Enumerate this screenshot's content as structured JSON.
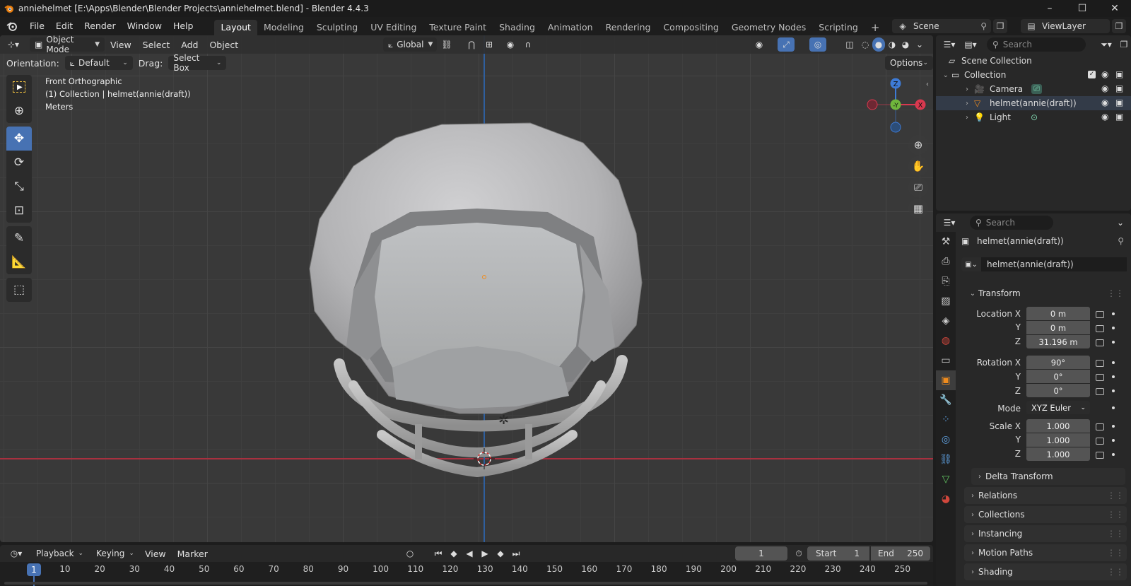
{
  "window": {
    "title": "anniehelmet [E:\\Apps\\Blender\\Blender Projects\\anniehelmet.blend] - Blender 4.4.3",
    "controls": [
      "–",
      "☐",
      "✕"
    ]
  },
  "menubar": {
    "items": [
      "File",
      "Edit",
      "Render",
      "Window",
      "Help"
    ],
    "workspaces": [
      "Layout",
      "Modeling",
      "Sculpting",
      "UV Editing",
      "Texture Paint",
      "Shading",
      "Animation",
      "Rendering",
      "Compositing",
      "Geometry Nodes",
      "Scripting"
    ],
    "active_workspace": "Layout",
    "add_tab": "+",
    "scene": "Scene",
    "view_layer": "ViewLayer"
  },
  "viewport": {
    "mode": "Object Mode",
    "menus": [
      "View",
      "Select",
      "Add",
      "Object"
    ],
    "transform_orientation": "Global",
    "orientation_label": "Orientation:",
    "orientation_value": "Default",
    "drag_label": "Drag:",
    "drag_value": "Select Box",
    "options_label": "Options",
    "overlay": {
      "view_name": "Front Orthographic",
      "collection_info": "(1) Collection | helmet(annie(draft))",
      "units": "Meters"
    },
    "gizmo": {
      "z": "Z",
      "y": "-Y",
      "x": "X"
    },
    "colors": {
      "x_axis": "#d9394f",
      "y_axis": "#6fb63c",
      "z_axis": "#3e7bd6",
      "active": "#4772b3"
    }
  },
  "outliner": {
    "search_placeholder": "Search",
    "root": "Scene Collection",
    "collection": "Collection",
    "objects": [
      "Camera",
      "helmet(annie(draft))",
      "Light"
    ]
  },
  "properties": {
    "search_placeholder": "Search",
    "object_name": "helmet(annie(draft))",
    "datablock_name": "helmet(annie(draft))",
    "transform": {
      "title": "Transform",
      "location_label": "Location X",
      "location": [
        "0 m",
        "0 m",
        "31.196 m"
      ],
      "rotation_label": "Rotation X",
      "rotation": [
        "90°",
        "0°",
        "0°"
      ],
      "mode_label": "Mode",
      "mode_value": "XYZ Euler",
      "scale_label": "Scale X",
      "scale": [
        "1.000",
        "1.000",
        "1.000"
      ],
      "axis_y": "Y",
      "axis_z": "Z"
    },
    "delta_transform": "Delta Transform",
    "panels": [
      "Relations",
      "Collections",
      "Instancing",
      "Motion Paths",
      "Shading"
    ]
  },
  "timeline": {
    "menus": [
      "Playback",
      "Keying",
      "View",
      "Marker"
    ],
    "current_frame": "1",
    "start_label": "Start",
    "start_value": "1",
    "end_label": "End",
    "end_value": "250",
    "ruler": [
      "10",
      "20",
      "30",
      "40",
      "50",
      "60",
      "70",
      "80",
      "90",
      "100",
      "110",
      "120",
      "130",
      "140",
      "150",
      "160",
      "170",
      "180",
      "190",
      "200",
      "210",
      "220",
      "230",
      "240",
      "250"
    ],
    "cursor_frame": "1"
  }
}
